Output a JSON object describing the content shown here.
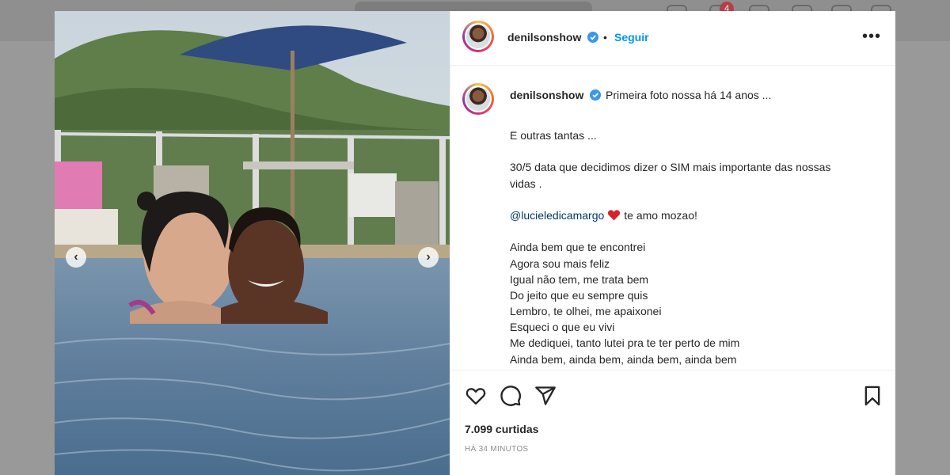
{
  "background": {
    "notification_count": "4"
  },
  "post": {
    "author": "denilsonshow",
    "follow_label": "Seguir",
    "separator": "•",
    "more_label": "•••",
    "caption_first": "Primeira foto nossa há 14 anos ...",
    "caption_lines": [
      "E outras tantas ...",
      "",
      "30/5 data que decidimos dizer o SIM mais importante das nossas",
      "vidas ."
    ],
    "mention": "@lucieledicamargo",
    "mention_text": "te amo mozao!",
    "song_lines": [
      "Ainda bem que te encontrei",
      "Agora sou mais feliz",
      "Igual não tem, me trata bem",
      "Do jeito que eu sempre quis",
      "Lembro, te olhei, me apaixonei",
      "Esqueci o que eu vivi",
      "Me dediquei, tanto lutei pra te ter perto de mim",
      "Ainda bem, ainda bem, ainda bem, ainda bem"
    ],
    "likes": "7.099 curtidas",
    "time": "HÁ 34 MINUTOS",
    "carousel_prev": "‹",
    "carousel_next": "›"
  },
  "colors": {
    "accent": "#0095f6",
    "verified": "#3897f0",
    "heart": "#d8222a"
  }
}
